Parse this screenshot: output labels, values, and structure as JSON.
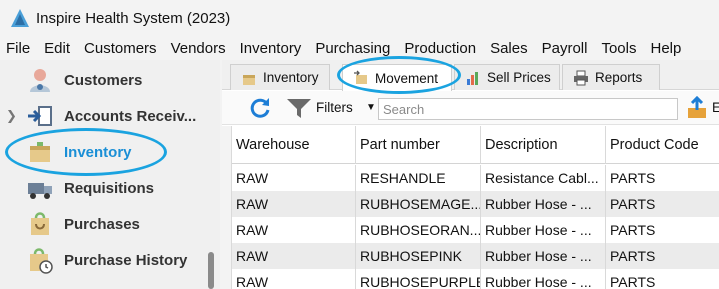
{
  "window": {
    "title": "Inspire Health System (2023)"
  },
  "menu": [
    "File",
    "Edit",
    "Customers",
    "Vendors",
    "Inventory",
    "Purchasing",
    "Production",
    "Sales",
    "Payroll",
    "Tools",
    "Help"
  ],
  "sidebar": {
    "items": [
      {
        "label": "Customers",
        "icon": "customers-icon"
      },
      {
        "label": "Accounts Receiv...",
        "icon": "accounts-receivable-icon",
        "expandable": true
      },
      {
        "label": "Inventory",
        "icon": "inventory-icon",
        "selected": true
      },
      {
        "label": "Requisitions",
        "icon": "requisitions-icon"
      },
      {
        "label": "Purchases",
        "icon": "purchases-icon"
      },
      {
        "label": "Purchase History",
        "icon": "purchase-history-icon"
      }
    ]
  },
  "tabs": [
    {
      "label": "Inventory",
      "icon": "inventory-tab-icon"
    },
    {
      "label": "Movement",
      "icon": "movement-tab-icon",
      "active": true
    },
    {
      "label": "Sell Prices",
      "icon": "sell-prices-tab-icon"
    },
    {
      "label": "Reports",
      "icon": "reports-tab-icon"
    }
  ],
  "toolbar": {
    "filters_label": "Filters",
    "search_placeholder": "Search",
    "export_label": "E"
  },
  "table": {
    "columns": [
      "Warehouse",
      "Part number",
      "Description",
      "Product Code"
    ],
    "rows": [
      [
        "RAW",
        "RESHANDLE",
        "Resistance Cabl...",
        "PARTS"
      ],
      [
        "RAW",
        "RUBHOSEMAGE...",
        "Rubber Hose - ...",
        "PARTS"
      ],
      [
        "RAW",
        "RUBHOSEORAN...",
        "Rubber Hose - ...",
        "PARTS"
      ],
      [
        "RAW",
        "RUBHOSEPINK",
        "Rubber Hose - ...",
        "PARTS"
      ],
      [
        "RAW",
        "RUBHOSEPURPLE",
        "Rubber Hose - ...",
        "PARTS"
      ]
    ]
  },
  "colors": {
    "highlight_ring": "#1aa3e0",
    "selected_text": "#1a8fd6",
    "row_alt": "#ebebeb"
  }
}
